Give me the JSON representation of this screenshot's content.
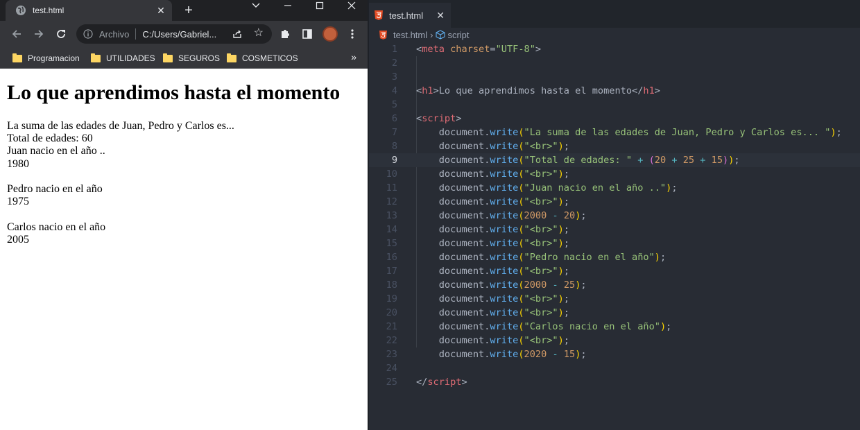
{
  "browser": {
    "tab_title": "test.html",
    "omnibox_scheme_label": "Archivo",
    "omnibox_url": "C:/Users/Gabriel...",
    "bookmarks": [
      "Programacion",
      "UTILIDADES",
      "SEGUROS",
      "COSMETICOS"
    ],
    "bookmarks_overflow": "»",
    "page": {
      "heading": "Lo que aprendimos hasta el momento",
      "output_lines": [
        "La suma de las edades de Juan, Pedro y Carlos es...",
        "Total de edades: 60",
        "Juan nacio en el año ..",
        "1980",
        "",
        "Pedro nacio en el año",
        "1975",
        "",
        "Carlos nacio en el año",
        "2005"
      ]
    }
  },
  "editor": {
    "tab_title": "test.html",
    "breadcrumb_file": "test.html",
    "breadcrumb_symbol": "script",
    "current_line": 9,
    "lines": [
      [
        [
          "t-punc",
          "<"
        ],
        [
          "t-tag",
          "meta"
        ],
        [
          "t-txt",
          " "
        ],
        [
          "t-attr",
          "charset"
        ],
        [
          "t-punc",
          "="
        ],
        [
          "t-str",
          "\"UTF-8\""
        ],
        [
          "t-punc",
          ">"
        ]
      ],
      [],
      [],
      [
        [
          "t-punc",
          "<"
        ],
        [
          "t-tag",
          "h1"
        ],
        [
          "t-punc",
          ">"
        ],
        [
          "t-txt",
          "Lo que aprendimos hasta el momento"
        ],
        [
          "t-punc",
          "</"
        ],
        [
          "t-tag",
          "h1"
        ],
        [
          "t-punc",
          ">"
        ]
      ],
      [],
      [
        [
          "t-punc",
          "<"
        ],
        [
          "t-tag",
          "script"
        ],
        [
          "t-punc",
          ">"
        ]
      ],
      [
        [
          "t-txt",
          "    document."
        ],
        [
          "t-fn",
          "write"
        ],
        [
          "t-p1",
          "("
        ],
        [
          "t-str",
          "\"La suma de las edades de Juan, Pedro y Carlos es... \""
        ],
        [
          "t-p1",
          ")"
        ],
        [
          "t-txt",
          ";"
        ]
      ],
      [
        [
          "t-txt",
          "    document."
        ],
        [
          "t-fn",
          "write"
        ],
        [
          "t-p1",
          "("
        ],
        [
          "t-str",
          "\"<br>\""
        ],
        [
          "t-p1",
          ")"
        ],
        [
          "t-txt",
          ";"
        ]
      ],
      [
        [
          "t-txt",
          "    document."
        ],
        [
          "t-fn",
          "write"
        ],
        [
          "t-p1",
          "("
        ],
        [
          "t-str",
          "\"Total de edades: \""
        ],
        [
          "t-txt",
          " "
        ],
        [
          "t-op",
          "+"
        ],
        [
          "t-txt",
          " "
        ],
        [
          "t-p2",
          "("
        ],
        [
          "t-num",
          "20"
        ],
        [
          "t-txt",
          " "
        ],
        [
          "t-op",
          "+"
        ],
        [
          "t-txt",
          " "
        ],
        [
          "t-num",
          "25"
        ],
        [
          "t-txt",
          " "
        ],
        [
          "t-op",
          "+"
        ],
        [
          "t-txt",
          " "
        ],
        [
          "t-num",
          "15"
        ],
        [
          "t-p2",
          ")"
        ],
        [
          "t-p1",
          ")"
        ],
        [
          "t-txt",
          ";"
        ]
      ],
      [
        [
          "t-txt",
          "    document."
        ],
        [
          "t-fn",
          "write"
        ],
        [
          "t-p1",
          "("
        ],
        [
          "t-str",
          "\"<br>\""
        ],
        [
          "t-p1",
          ")"
        ],
        [
          "t-txt",
          ";"
        ]
      ],
      [
        [
          "t-txt",
          "    document."
        ],
        [
          "t-fn",
          "write"
        ],
        [
          "t-p1",
          "("
        ],
        [
          "t-str",
          "\"Juan nacio en el año ..\""
        ],
        [
          "t-p1",
          ")"
        ],
        [
          "t-txt",
          ";"
        ]
      ],
      [
        [
          "t-txt",
          "    document."
        ],
        [
          "t-fn",
          "write"
        ],
        [
          "t-p1",
          "("
        ],
        [
          "t-str",
          "\"<br>\""
        ],
        [
          "t-p1",
          ")"
        ],
        [
          "t-txt",
          ";"
        ]
      ],
      [
        [
          "t-txt",
          "    document."
        ],
        [
          "t-fn",
          "write"
        ],
        [
          "t-p1",
          "("
        ],
        [
          "t-num",
          "2000"
        ],
        [
          "t-txt",
          " "
        ],
        [
          "t-op",
          "-"
        ],
        [
          "t-txt",
          " "
        ],
        [
          "t-num",
          "20"
        ],
        [
          "t-p1",
          ")"
        ],
        [
          "t-txt",
          ";"
        ]
      ],
      [
        [
          "t-txt",
          "    document."
        ],
        [
          "t-fn",
          "write"
        ],
        [
          "t-p1",
          "("
        ],
        [
          "t-str",
          "\"<br>\""
        ],
        [
          "t-p1",
          ")"
        ],
        [
          "t-txt",
          ";"
        ]
      ],
      [
        [
          "t-txt",
          "    document."
        ],
        [
          "t-fn",
          "write"
        ],
        [
          "t-p1",
          "("
        ],
        [
          "t-str",
          "\"<br>\""
        ],
        [
          "t-p1",
          ")"
        ],
        [
          "t-txt",
          ";"
        ]
      ],
      [
        [
          "t-txt",
          "    document."
        ],
        [
          "t-fn",
          "write"
        ],
        [
          "t-p1",
          "("
        ],
        [
          "t-str",
          "\"Pedro nacio en el año\""
        ],
        [
          "t-p1",
          ")"
        ],
        [
          "t-txt",
          ";"
        ]
      ],
      [
        [
          "t-txt",
          "    document."
        ],
        [
          "t-fn",
          "write"
        ],
        [
          "t-p1",
          "("
        ],
        [
          "t-str",
          "\"<br>\""
        ],
        [
          "t-p1",
          ")"
        ],
        [
          "t-txt",
          ";"
        ]
      ],
      [
        [
          "t-txt",
          "    document."
        ],
        [
          "t-fn",
          "write"
        ],
        [
          "t-p1",
          "("
        ],
        [
          "t-num",
          "2000"
        ],
        [
          "t-txt",
          " "
        ],
        [
          "t-op",
          "-"
        ],
        [
          "t-txt",
          " "
        ],
        [
          "t-num",
          "25"
        ],
        [
          "t-p1",
          ")"
        ],
        [
          "t-txt",
          ";"
        ]
      ],
      [
        [
          "t-txt",
          "    document."
        ],
        [
          "t-fn",
          "write"
        ],
        [
          "t-p1",
          "("
        ],
        [
          "t-str",
          "\"<br>\""
        ],
        [
          "t-p1",
          ")"
        ],
        [
          "t-txt",
          ";"
        ]
      ],
      [
        [
          "t-txt",
          "    document."
        ],
        [
          "t-fn",
          "write"
        ],
        [
          "t-p1",
          "("
        ],
        [
          "t-str",
          "\"<br>\""
        ],
        [
          "t-p1",
          ")"
        ],
        [
          "t-txt",
          ";"
        ]
      ],
      [
        [
          "t-txt",
          "    document."
        ],
        [
          "t-fn",
          "write"
        ],
        [
          "t-p1",
          "("
        ],
        [
          "t-str",
          "\"Carlos nacio en el año\""
        ],
        [
          "t-p1",
          ")"
        ],
        [
          "t-txt",
          ";"
        ]
      ],
      [
        [
          "t-txt",
          "    document."
        ],
        [
          "t-fn",
          "write"
        ],
        [
          "t-p1",
          "("
        ],
        [
          "t-str",
          "\"<br>\""
        ],
        [
          "t-p1",
          ")"
        ],
        [
          "t-txt",
          ";"
        ]
      ],
      [
        [
          "t-txt",
          "    document."
        ],
        [
          "t-fn",
          "write"
        ],
        [
          "t-p1",
          "("
        ],
        [
          "t-num",
          "2020"
        ],
        [
          "t-txt",
          " "
        ],
        [
          "t-op",
          "-"
        ],
        [
          "t-txt",
          " "
        ],
        [
          "t-num",
          "15"
        ],
        [
          "t-p1",
          ")"
        ],
        [
          "t-txt",
          ";"
        ]
      ],
      [],
      [
        [
          "t-punc",
          "</"
        ],
        [
          "t-tag",
          "script"
        ],
        [
          "t-punc",
          ">"
        ]
      ]
    ]
  }
}
